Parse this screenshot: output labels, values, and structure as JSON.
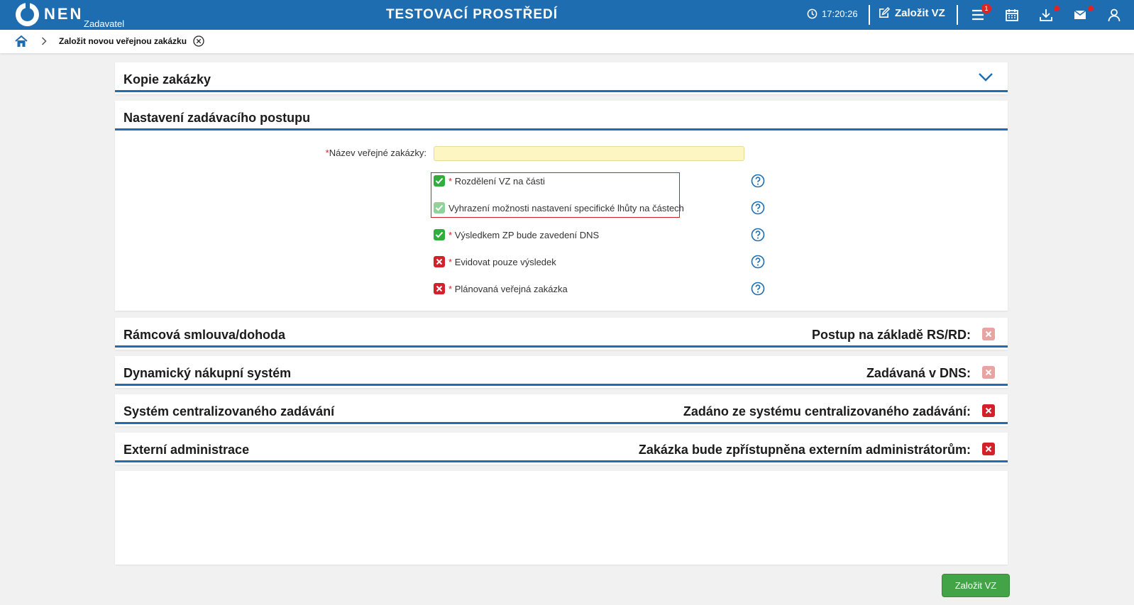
{
  "header": {
    "logo_text": "NEN",
    "logo_subtitle": "Zadavatel",
    "environment_title": "TESTOVACÍ PROSTŘEDÍ",
    "clock_time": "17:20:26",
    "create_vz_label": "Založit VZ",
    "menu_badge": "1"
  },
  "breadcrumb": {
    "current": "Založit novou veřejnou zakázku"
  },
  "panels": {
    "copy": {
      "title": "Kopie zakázky"
    },
    "settings": {
      "title": "Nastavení zadávacího postupu"
    },
    "framework": {
      "title": "Rámcová smlouva/dohoda",
      "right_label": "Postup na základě RS/RD:"
    },
    "dns": {
      "title": "Dynamický nákupní systém",
      "right_label": "Zadávaná v DNS:"
    },
    "central": {
      "title": "Systém centralizovaného zadávání",
      "right_label": "Zadáno ze systému centralizovaného zadávání:"
    },
    "external": {
      "title": "Externí administrace",
      "right_label": "Zakázka bude zpřístupněna externím administrátorům:"
    }
  },
  "form": {
    "name_label": "Název veřejné zakázky:",
    "name_value": "",
    "required_mark": "*",
    "checkboxes": [
      {
        "label": "Rozdělení VZ na části",
        "required": true,
        "state": "checked"
      },
      {
        "label": "Vyhrazení možnosti nastavení specifické lhůty na částech",
        "required": false,
        "state": "checked-disabled"
      },
      {
        "label": "Výsledkem ZP bude zavedení DNS",
        "required": true,
        "state": "checked"
      },
      {
        "label": "Evidovat pouze výsledek",
        "required": true,
        "state": "unchecked"
      },
      {
        "label": "Plánovaná veřejná zakázka",
        "required": true,
        "state": "unchecked"
      }
    ]
  },
  "footer": {
    "create_button": "Založit VZ"
  },
  "colors": {
    "brand_blue": "#1f6db1",
    "check_green": "#2fae3d",
    "cross_red": "#d4202a",
    "input_yellow": "#fdf6c3",
    "button_green": "#43a447"
  }
}
